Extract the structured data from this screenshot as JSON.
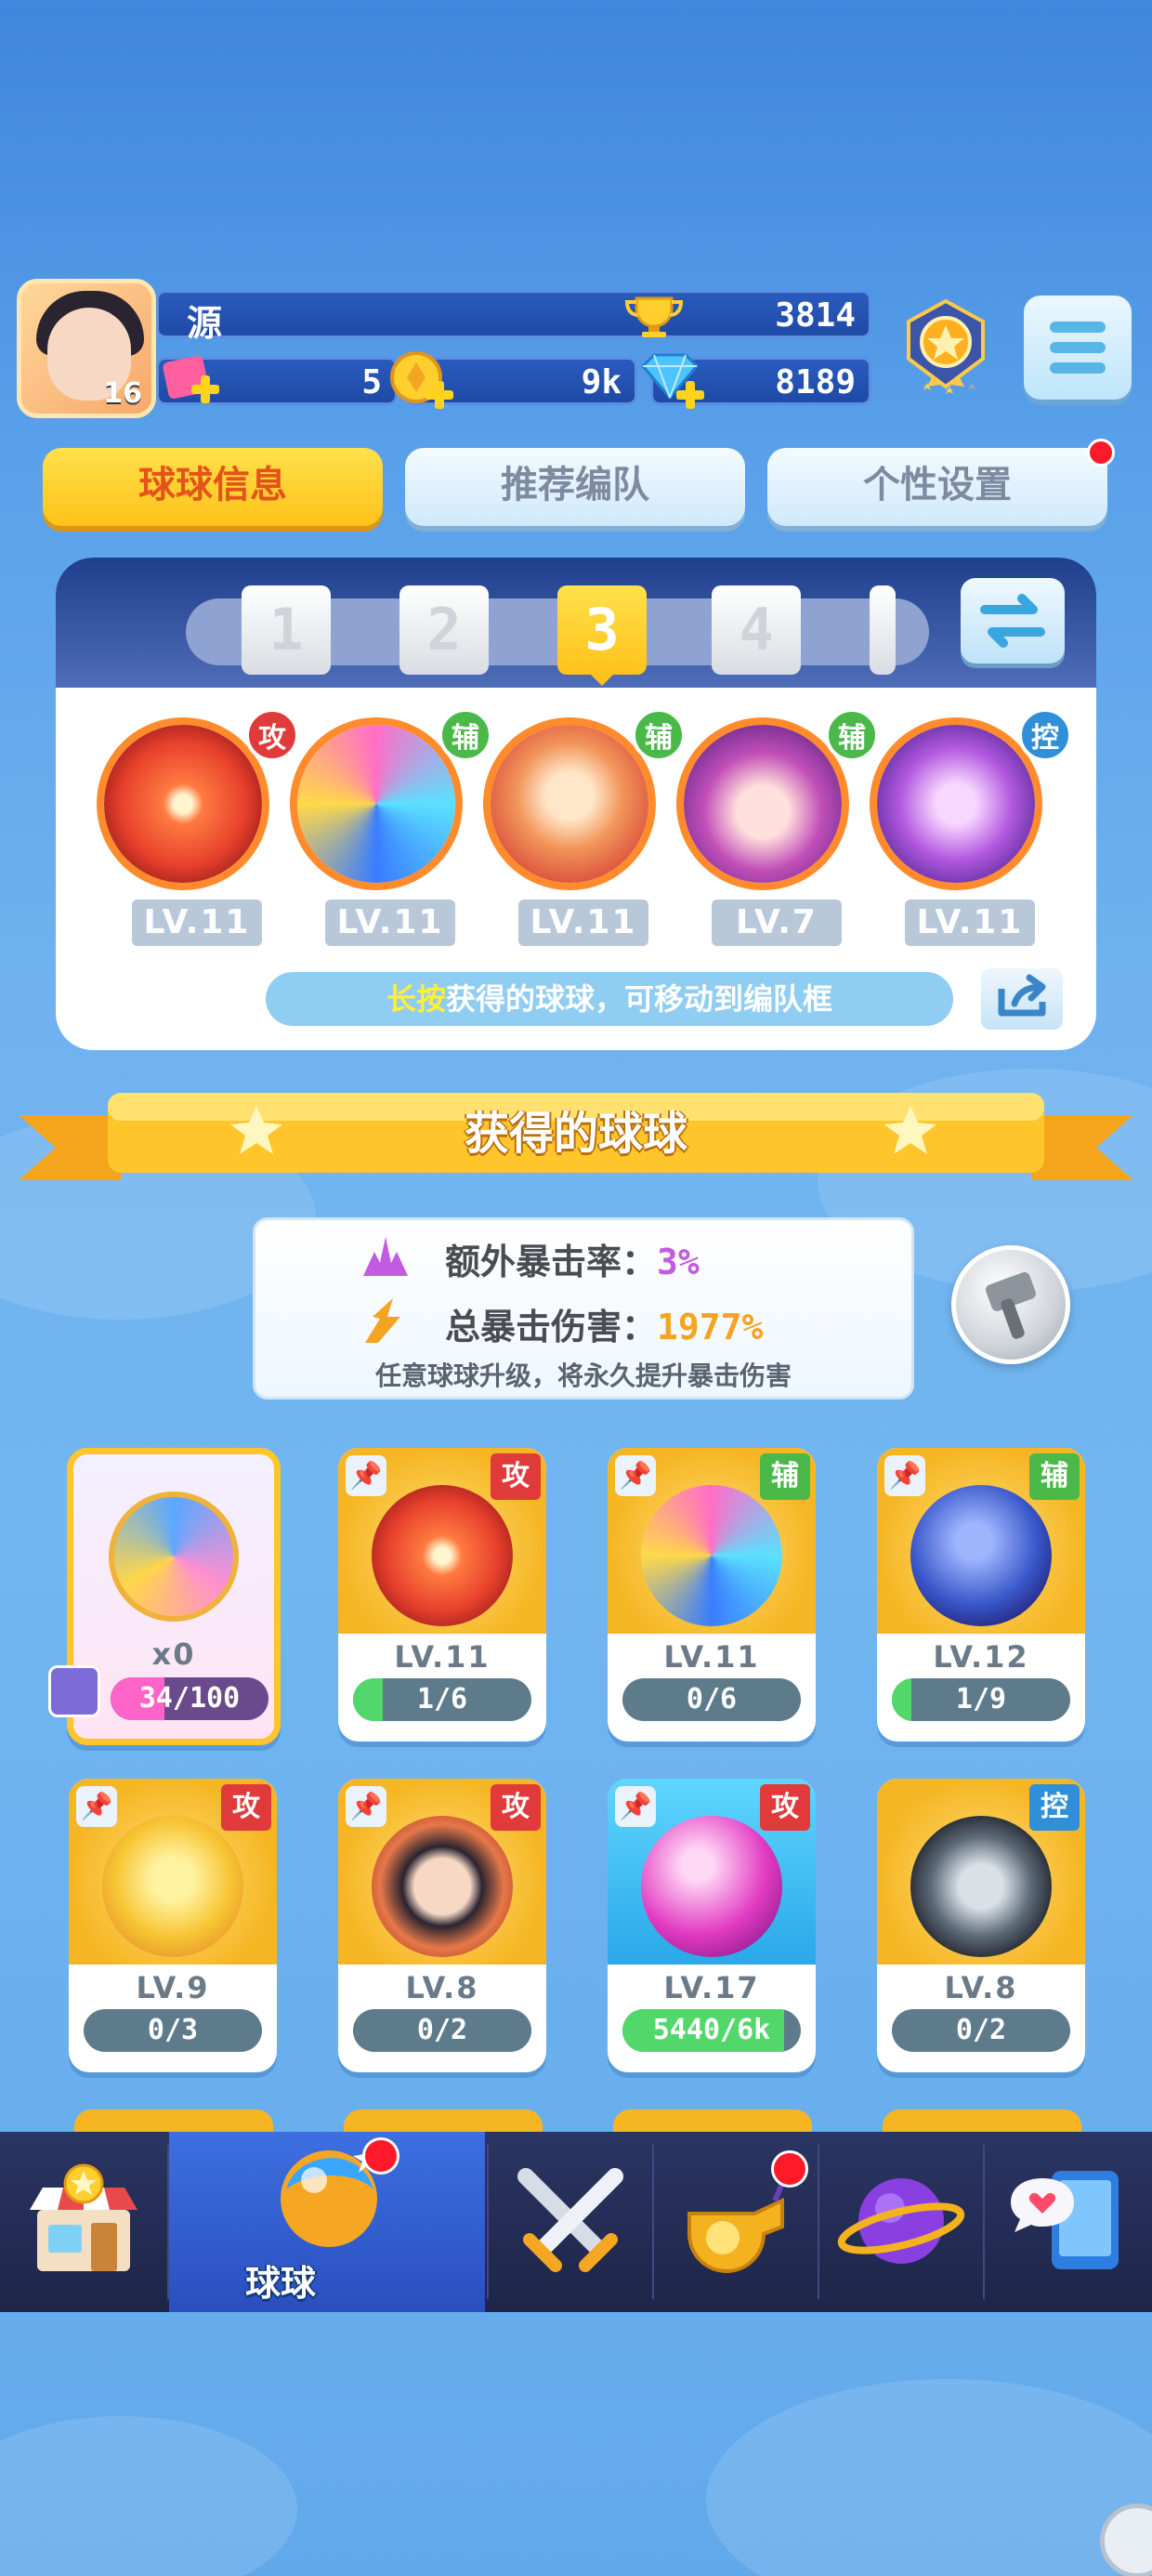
{
  "header": {
    "player_name": "源",
    "avatar_level": "16",
    "trophies": "3814",
    "tickets": "5",
    "coins": "9k",
    "gems": "8189"
  },
  "tabs": [
    {
      "label": "球球信息",
      "active": true
    },
    {
      "label": "推荐编队",
      "active": false
    },
    {
      "label": "个性设置",
      "active": false,
      "notification": true
    }
  ],
  "team_panel": {
    "slots": [
      "1",
      "2",
      "3",
      "4"
    ],
    "selected_slot": "3",
    "balls": [
      {
        "type": "攻",
        "level": "LV.11",
        "color": "#e8412c"
      },
      {
        "type": "辅",
        "level": "LV.11",
        "color": "#33b7e8"
      },
      {
        "type": "辅",
        "level": "LV.11",
        "color": "#f28a3a"
      },
      {
        "type": "辅",
        "level": "LV.7",
        "color": "#c24fb8"
      },
      {
        "type": "控",
        "level": "LV.11",
        "color": "#b359e0"
      }
    ],
    "hint_highlight": "长按",
    "hint_text": "获得的球球，可移动到编队框"
  },
  "section_title": "获得的球球",
  "stats": {
    "extra_crit_label": "额外暴击率：",
    "extra_crit_value": "3%",
    "total_crit_label": "总暴击伤害：",
    "total_crit_value": "1977%",
    "note": "任意球球升级，将永久提升暴击伤害"
  },
  "cards": [
    {
      "special": true,
      "count": "x0",
      "progress": "34/100",
      "fill": 0.34
    },
    {
      "type": "攻",
      "level": "LV.11",
      "progress": "1/6",
      "fill": 0.1667,
      "color": "#e8412c"
    },
    {
      "type": "辅",
      "level": "LV.11",
      "progress": "0/6",
      "fill": 0.0,
      "color": "#33b7e8"
    },
    {
      "type": "辅",
      "level": "LV.12",
      "progress": "1/9",
      "fill": 0.1111,
      "color": "#3857c9"
    },
    {
      "type": "攻",
      "level": "LV.9",
      "progress": "0/3",
      "fill": 0.0,
      "color": "#f7c533"
    },
    {
      "type": "攻",
      "level": "LV.8",
      "progress": "0/2",
      "fill": 0.0,
      "color": "#e6784a"
    },
    {
      "type": "攻",
      "level": "LV.17",
      "progress": "5440/6k",
      "fill": 0.9067,
      "color": "#e23bc2",
      "blue": true
    },
    {
      "type": "控",
      "level": "LV.8",
      "progress": "0/2",
      "fill": 0.0,
      "color": "#5d6a78"
    }
  ],
  "nav": {
    "items": [
      "shop-icon",
      "ball-icon",
      "battle-icon",
      "whistle-icon",
      "planet-icon",
      "chat-icon"
    ],
    "active_label": "球球"
  },
  "colors": {
    "attack": "#e03a3a",
    "support": "#4bb84a",
    "control": "#2f8fd8",
    "tab_active": "#ffd21e",
    "crit_purple": "#c25be0",
    "crit_orange": "#f6a321"
  }
}
